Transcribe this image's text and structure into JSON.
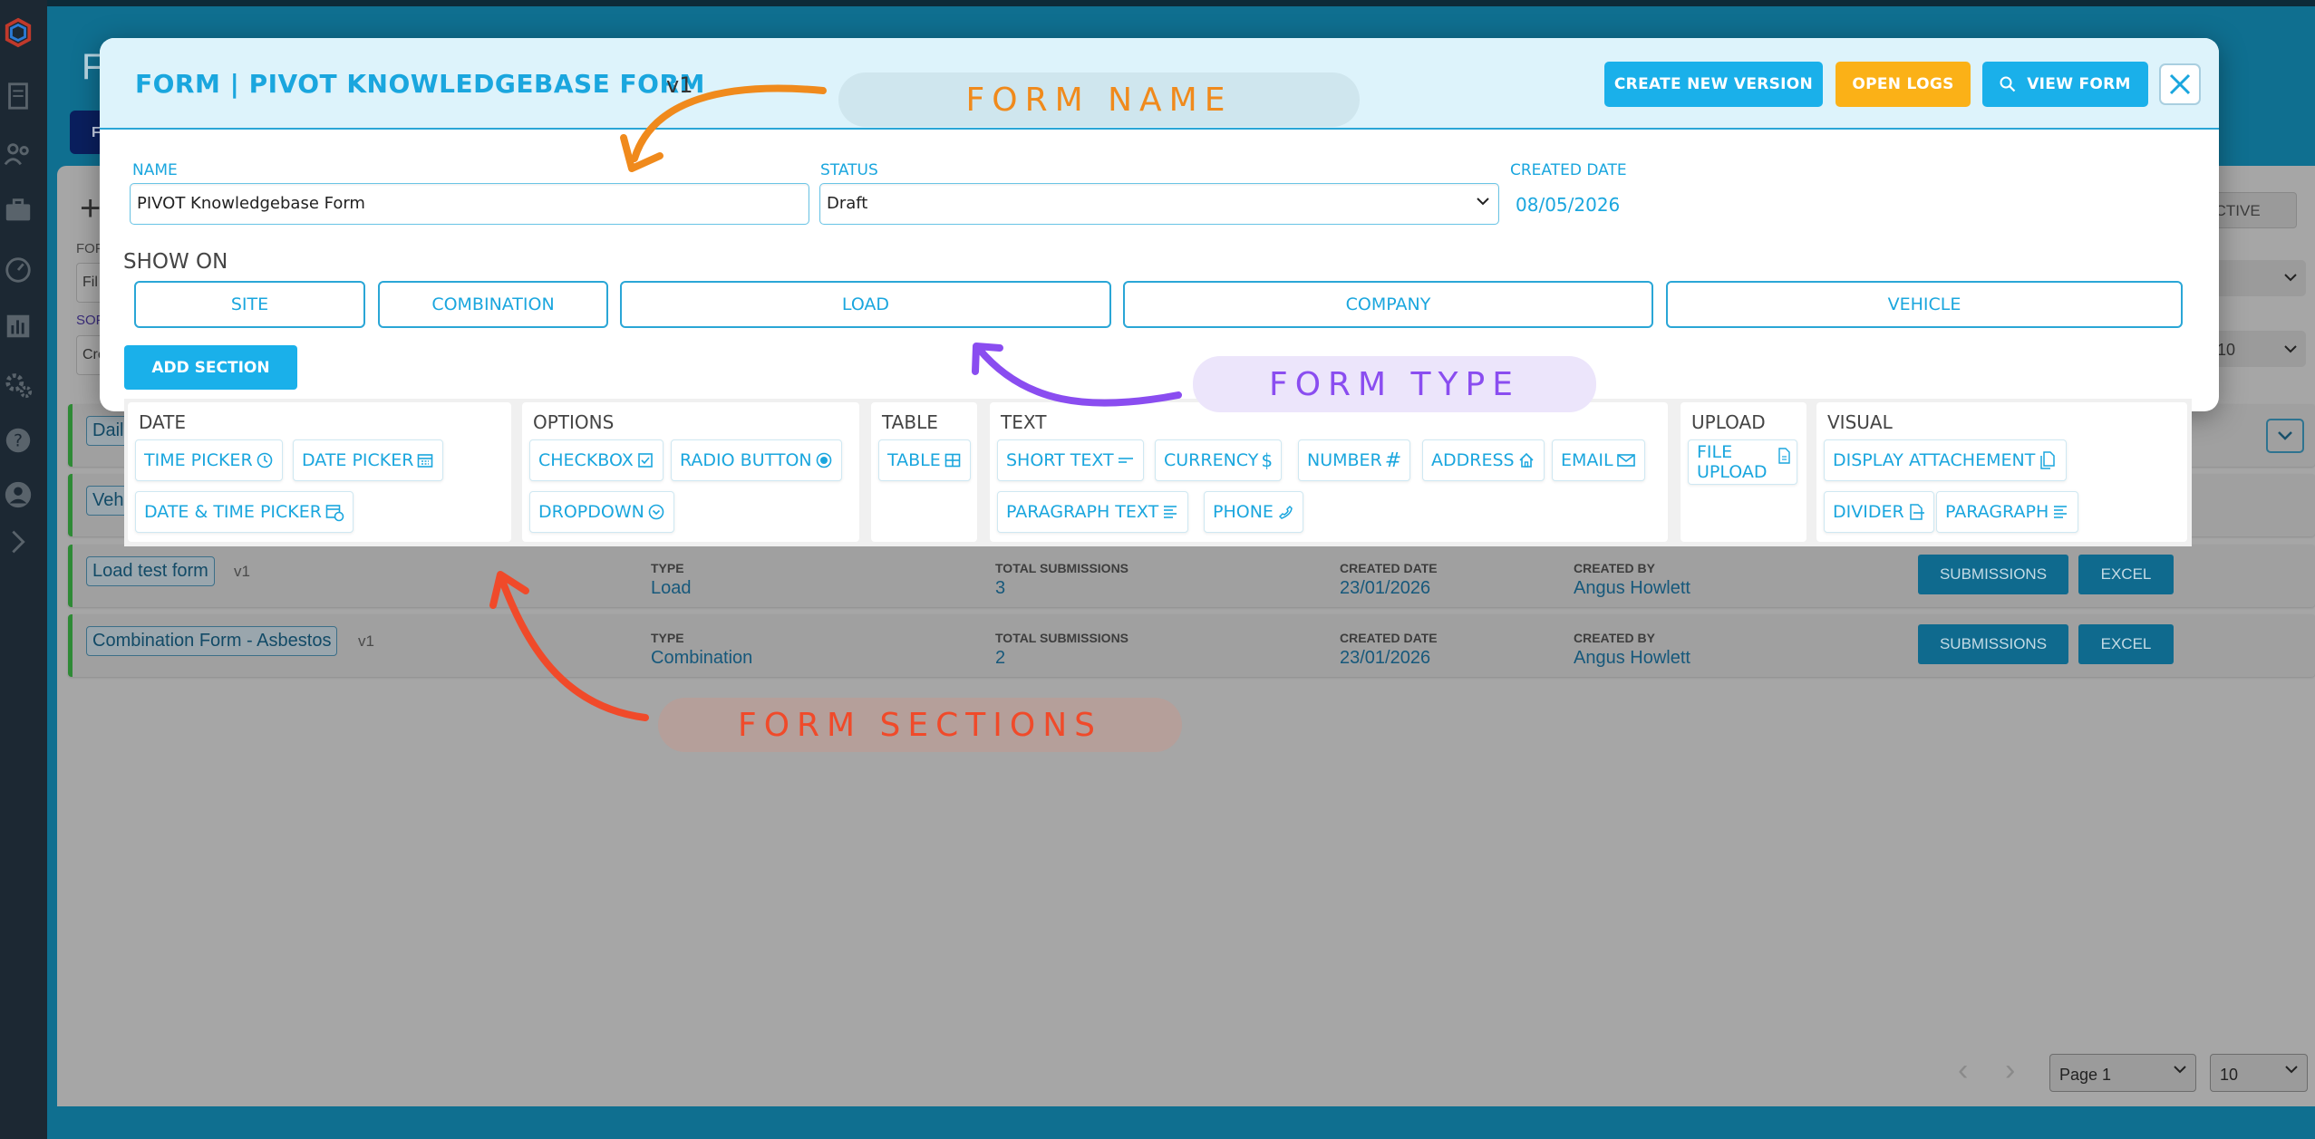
{
  "background": {
    "app_title": "F",
    "nav_button_label": "F",
    "inactive_label": "NACTIVE",
    "filter_labels": [
      "FOF",
      "SOF"
    ],
    "filter_input_prefix": "Fil",
    "sort_input_prefix": "Cre",
    "page_size_value": "10",
    "rows": [
      {
        "name": "Dail",
        "version": "",
        "type_label": "",
        "type": "",
        "subs_label": "",
        "subs": "",
        "date_label": "",
        "date": "",
        "by_label": "",
        "by": ""
      },
      {
        "name": "Veh",
        "version": "",
        "type_label": "",
        "type": "",
        "subs_label": "",
        "subs": "",
        "date_label": "",
        "date": "",
        "by_label": "",
        "by": ""
      },
      {
        "name": "Load test form",
        "version": "v1",
        "type_label": "TYPE",
        "type": "Load",
        "subs_label": "TOTAL SUBMISSIONS",
        "subs": "3",
        "date_label": "CREATED DATE",
        "date": "23/01/2026",
        "by_label": "CREATED BY",
        "by": "Angus Howlett",
        "btn_submissions": "SUBMISSIONS",
        "btn_excel": "EXCEL"
      },
      {
        "name": "Combination Form - Asbestos",
        "version": "v1",
        "type_label": "TYPE",
        "type": "Combination",
        "subs_label": "TOTAL SUBMISSIONS",
        "subs": "2",
        "date_label": "CREATED DATE",
        "date": "23/01/2026",
        "by_label": "CREATED BY",
        "by": "Angus Howlett",
        "btn_submissions": "SUBMISSIONS",
        "btn_excel": "EXCEL"
      }
    ],
    "pager": {
      "page_value": "Page 1",
      "size_value": "10"
    }
  },
  "modal": {
    "title": "FORM | PIVOT KNOWLEDGEBASE FORM",
    "version": "v1",
    "buttons": {
      "create_new_version": "CREATE NEW VERSION",
      "open_logs": "OPEN LOGS",
      "view_form": "VIEW FORM"
    },
    "fields": {
      "name_label": "NAME",
      "name_value": "PIVOT Knowledgebase Form",
      "status_label": "STATUS",
      "status_value": "Draft",
      "created_label": "CREATED DATE",
      "created_value": "08/05/2026"
    },
    "show_on_label": "SHOW ON",
    "show_on_options": [
      "SITE",
      "COMBINATION",
      "LOAD",
      "COMPANY",
      "VEHICLE"
    ],
    "add_section_label": "ADD SECTION"
  },
  "palette": {
    "date": {
      "title": "DATE",
      "items": [
        "TIME PICKER",
        "DATE PICKER",
        "DATE & TIME PICKER"
      ]
    },
    "options": {
      "title": "OPTIONS",
      "items": [
        "CHECKBOX",
        "RADIO BUTTON",
        "DROPDOWN"
      ]
    },
    "table": {
      "title": "TABLE",
      "items": [
        "TABLE"
      ]
    },
    "text": {
      "title": "TEXT",
      "items": [
        "SHORT TEXT",
        "CURRENCY",
        "NUMBER",
        "ADDRESS",
        "EMAIL",
        "PARAGRAPH TEXT",
        "PHONE"
      ]
    },
    "upload": {
      "title": "UPLOAD",
      "items": [
        "FILE",
        "UPLOAD"
      ]
    },
    "visual": {
      "title": "VISUAL",
      "items": [
        "DISPLAY ATTACHEMENT",
        "DIVIDER",
        "PARAGRAPH"
      ]
    }
  },
  "annotations": {
    "form_name": "FORM NAME",
    "form_type": "FORM TYPE",
    "form_sections": "FORM SECTIONS"
  },
  "colors": {
    "accent": "#1aa6de",
    "button_blue": "#1ab0ea",
    "button_orange": "#fbb117",
    "annotation_orange": "#f08a1c",
    "annotation_purple": "#8a4df0",
    "annotation_red": "#f04a2a"
  }
}
